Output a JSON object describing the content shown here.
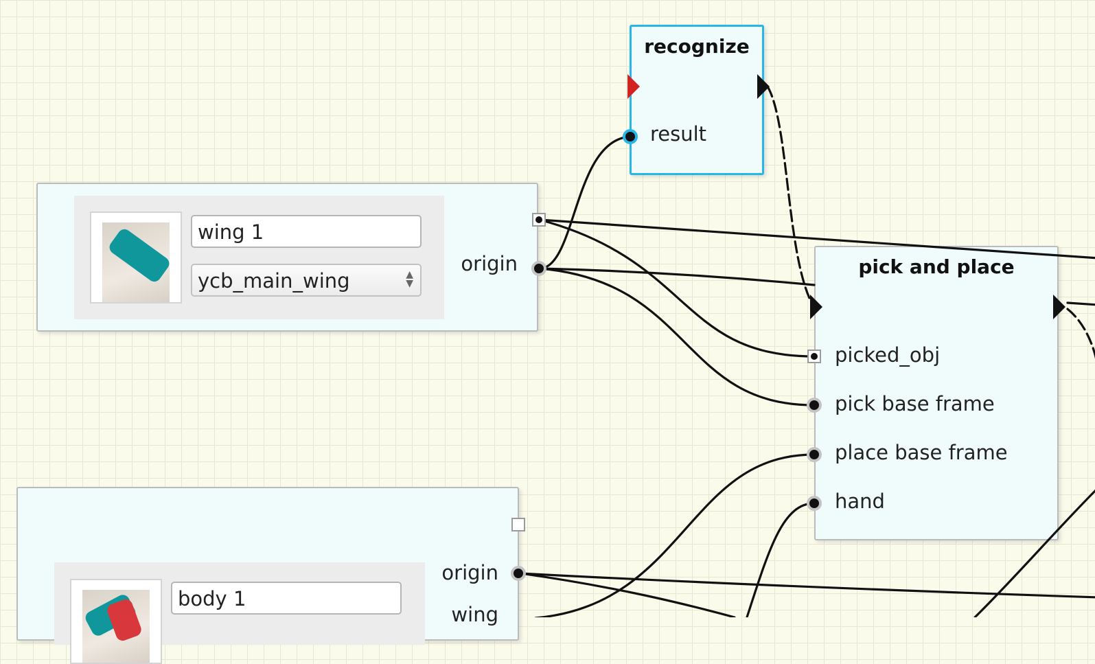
{
  "nodes": {
    "recognize": {
      "title": "recognize",
      "ports": {
        "result": "result"
      }
    },
    "pick_and_place": {
      "title": "pick and place",
      "ports": {
        "picked_obj": "picked_obj",
        "pick_base_frame": "pick base frame",
        "place_base_frame": "place base frame",
        "hand": "hand"
      }
    },
    "wing_object": {
      "name_value": "wing 1",
      "type_value": "ycb_main_wing",
      "ports": {
        "origin": "origin"
      }
    },
    "body_object": {
      "name_value": "body 1",
      "ports": {
        "origin": "origin",
        "wing": "wing"
      }
    }
  },
  "colors": {
    "canvas": "#fbfbec",
    "grid": "#e8e8d2",
    "node_fill": "#f0fcfb",
    "selected_border": "#28b6e8",
    "wire": "#111111",
    "exec_input_active": "#d22222",
    "object_teal": "#10979c",
    "object_red": "#d8383c"
  },
  "icons": {
    "wing_thumbnail": "wing-thumbnail-image",
    "body_thumbnail": "body-thumbnail-image",
    "combo_arrows": "spin-arrows-icon"
  }
}
